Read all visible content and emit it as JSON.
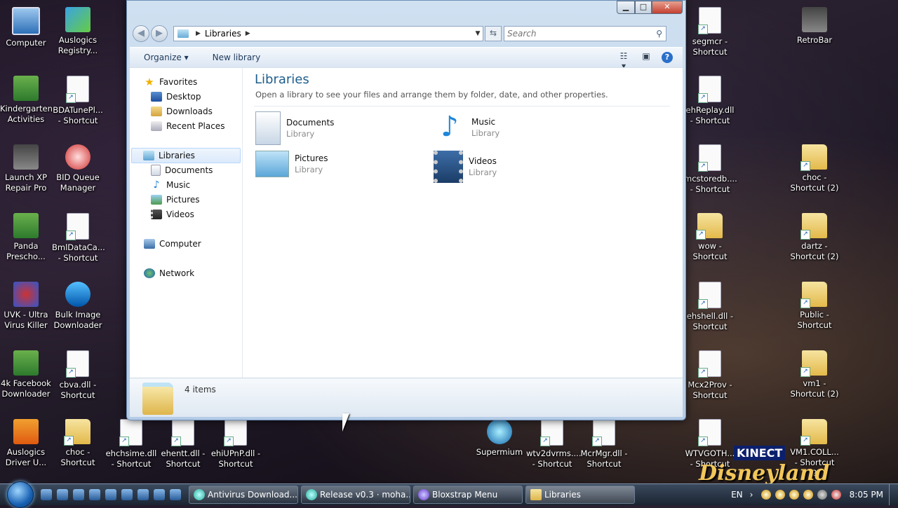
{
  "desktop": {
    "icons_left": [
      {
        "label": "Computer",
        "kind": "pc"
      },
      {
        "label": "Auslogics Registry...",
        "kind": "app1"
      },
      {
        "label": "Kindergarten Activities",
        "kind": "app3"
      },
      {
        "label": "BDATunePl... - Shortcut",
        "kind": "file"
      },
      {
        "label": "Launch XP Repair Pro",
        "kind": "app6"
      },
      {
        "label": "BID Queue Manager",
        "kind": "app2"
      },
      {
        "label": "Panda Prescho...",
        "kind": "app3"
      },
      {
        "label": "BmlDataCa... - Shortcut",
        "kind": "file"
      },
      {
        "label": "UVK - Ultra Virus Killer",
        "kind": "app7"
      },
      {
        "label": "Bulk Image Downloader",
        "kind": "app8"
      },
      {
        "label": "4k Facebook Downloader",
        "kind": "app3"
      },
      {
        "label": "cbva.dll - Shortcut",
        "kind": "file"
      },
      {
        "label": "Auslogics Driver U...",
        "kind": "app4"
      },
      {
        "label": "choc - Shortcut",
        "kind": "folder"
      }
    ],
    "icons_bottom": [
      {
        "label": "ehchsime.dll - Shortcut",
        "kind": "file"
      },
      {
        "label": "ehentt.dll - Shortcut",
        "kind": "file"
      },
      {
        "label": "ehiUPnP.dll - Shortcut",
        "kind": "file"
      },
      {
        "label": "Supermium",
        "kind": "app5"
      },
      {
        "label": "wtv2dvrms.... - Shortcut",
        "kind": "file"
      },
      {
        "label": "McrMgr.dll - Shortcut",
        "kind": "file"
      }
    ],
    "icons_right": [
      {
        "label": "segmcr - Shortcut",
        "kind": "file"
      },
      {
        "label": "RetroBar",
        "kind": "app6"
      },
      {
        "label": "ehReplay.dll - Shortcut",
        "kind": "file"
      },
      {
        "label": "mcstoredb.... - Shortcut",
        "kind": "file"
      },
      {
        "label": "choc - Shortcut (2)",
        "kind": "folder"
      },
      {
        "label": "wow - Shortcut",
        "kind": "folder"
      },
      {
        "label": "dartz - Shortcut (2)",
        "kind": "folder"
      },
      {
        "label": "ehshell.dll - Shortcut",
        "kind": "file"
      },
      {
        "label": "Public - Shortcut",
        "kind": "folder"
      },
      {
        "label": "Mcx2Prov - Shortcut",
        "kind": "file"
      },
      {
        "label": "vm1 - Shortcut (2)",
        "kind": "folder"
      },
      {
        "label": "WTVGOTH... - Shortcut",
        "kind": "file"
      },
      {
        "label": "VM1.COLL... - Shortcut (2)",
        "kind": "folder"
      }
    ],
    "wallpaper": {
      "kinect": "KINECT",
      "logo": "Disneyland"
    }
  },
  "window": {
    "caption": {
      "min": "▁",
      "max": "□",
      "close": "✕"
    },
    "address": {
      "location": "Libraries"
    },
    "search": {
      "placeholder": "Search"
    },
    "toolbar": {
      "organize": "Organize ▾",
      "new_library": "New library",
      "help": "?"
    },
    "nav": {
      "favorites": "Favorites",
      "desktop": "Desktop",
      "downloads": "Downloads",
      "recent": "Recent Places",
      "libraries": "Libraries",
      "documents": "Documents",
      "music": "Music",
      "pictures": "Pictures",
      "videos": "Videos",
      "computer": "Computer",
      "network": "Network"
    },
    "main": {
      "title": "Libraries",
      "subtitle": "Open a library to see your files and arrange them by folder, date, and other properties.",
      "libraries": [
        {
          "name": "Documents",
          "type": "Library"
        },
        {
          "name": "Music",
          "type": "Library"
        },
        {
          "name": "Pictures",
          "type": "Library"
        },
        {
          "name": "Videos",
          "type": "Library"
        }
      ]
    },
    "details": {
      "count": "4 items"
    }
  },
  "taskbar": {
    "tasks": [
      {
        "label": "Antivirus Download..."
      },
      {
        "label": "Release v0.3 · moha..."
      },
      {
        "label": "Bloxstrap Menu"
      },
      {
        "label": "Libraries"
      }
    ],
    "language": "EN",
    "clock": "8:05 PM"
  }
}
